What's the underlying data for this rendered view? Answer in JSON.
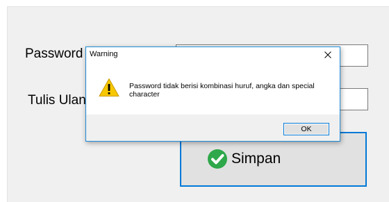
{
  "form": {
    "password_label": "Password",
    "retype_label": "Tulis Ulan",
    "password_value": "",
    "retype_value": "",
    "save_label": "Simpan"
  },
  "dialog": {
    "title": "Warning",
    "close_glyph": "✕",
    "message": "Password tidak berisi kombinasi huruf, angka dan special character",
    "ok_label": "OK",
    "icon": "warning-triangle-icon"
  },
  "colors": {
    "accent": "#0078d7",
    "form_background": "#f0f0f0",
    "button_face": "#e1e1e1",
    "warning_yellow": "#f7c700",
    "check_green": "#2ea84a"
  }
}
